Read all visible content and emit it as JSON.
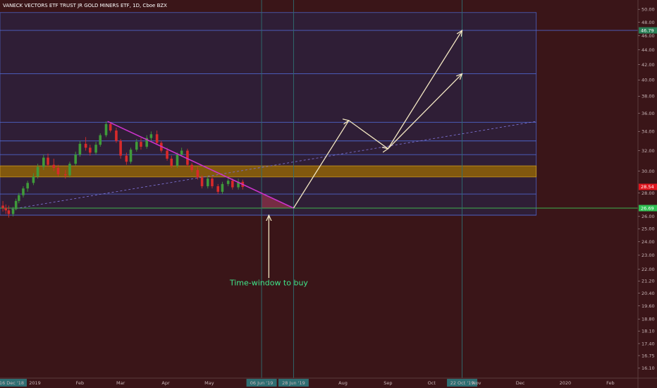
{
  "header": {
    "title": "VANECK VECTORS ETF TRUST JR GOLD MINERS ETF, 1D, Cboe BZX"
  },
  "colors": {
    "background": "#3a1518",
    "range_box": "#2f1f38",
    "range_lines": "#4f63c8",
    "resistance_band": "#8a5f0a",
    "support_line": "#3fb34f",
    "trendline": "#cc33cc",
    "arrow": "#f2e6c2",
    "up_candle": "#3f9a3a",
    "down_candle": "#d82a2a",
    "annotation_text": "#3fe58a",
    "price_tag_red": "#e0161e",
    "price_tag_green": "#2fbf52",
    "price_tag_last": "#2a7f56"
  },
  "annotation": {
    "label": "Time-window to buy"
  },
  "chart_data": {
    "type": "candlestick",
    "title": "VANECK VECTORS ETF TRUST JR GOLD MINERS ETF, 1D, Cboe BZX",
    "y_scale": "log",
    "ylim": [
      15.6,
      51.5
    ],
    "y_ticks": [
      "50.00",
      "48.00",
      "46.00",
      "44.00",
      "42.00",
      "40.00",
      "38.00",
      "36.00",
      "34.00",
      "32.00",
      "30.00",
      "28.00",
      "26.00",
      "25.00",
      "24.00",
      "23.00",
      "22.00",
      "21.20",
      "20.40",
      "19.60",
      "18.80",
      "18.10",
      "17.40",
      "16.75",
      "16.10"
    ],
    "x_tick_labels": [
      "16 Dec '18",
      "2019",
      "Feb",
      "Mar",
      "Apr",
      "May",
      "06 Jun '19",
      "28 Jun '19",
      "Aug",
      "Sep",
      "Oct",
      "22 Oct '19",
      "Nov",
      "Dec",
      "2020",
      "Feb"
    ],
    "x_range": [
      "2018-12-08",
      "2020-02-20"
    ],
    "price_tags": [
      {
        "label": "46.79",
        "value": 46.79,
        "style": "last"
      },
      {
        "label": "28.54",
        "value": 28.54,
        "style": "red"
      },
      {
        "label": "26.69",
        "value": 26.69,
        "style": "green"
      }
    ],
    "range_box": {
      "from": "2018-12-08",
      "to": "2019-12-12",
      "low": 26.1,
      "high": 49.5
    },
    "horizontal_levels": [
      46.79,
      40.8,
      35.0,
      33.0,
      31.6,
      27.9,
      26.1
    ],
    "resistance_band": [
      29.45,
      30.5
    ],
    "support_line": 26.69,
    "vertical_markers": [
      "2019-06-06",
      "2019-06-28",
      "2019-10-22"
    ],
    "trendline": {
      "from": [
        "2019-02-20",
        35.1
      ],
      "to": [
        "2019-06-28",
        26.69
      ]
    },
    "dashed_trendline": {
      "from": [
        "2018-12-16",
        26.6
      ],
      "to": [
        "2019-12-12",
        35.1
      ]
    },
    "shaded_window": [
      "2019-06-06",
      "2019-06-28"
    ],
    "projection_paths": [
      [
        [
          "2019-06-28",
          26.69
        ],
        [
          "2019-08-05",
          35.2
        ],
        [
          "2019-09-01",
          32.2
        ],
        [
          "2019-10-22",
          46.79
        ]
      ],
      [
        [
          "2019-09-01",
          32.2
        ],
        [
          "2019-10-22",
          40.8
        ]
      ]
    ],
    "annotation_arrow": {
      "from": [
        "2019-06-11",
        21.4
      ],
      "to": [
        "2019-06-11",
        26.1
      ]
    },
    "annotation_text": {
      "text": "Time-window to buy",
      "date": "2019-06-11",
      "value": 20.9
    },
    "ohlc": [
      {
        "d": "2018-12-10",
        "o": 26.9,
        "h": 27.3,
        "l": 26.4,
        "c": 26.7
      },
      {
        "d": "2018-12-12",
        "o": 26.7,
        "h": 27.0,
        "l": 26.2,
        "c": 26.5
      },
      {
        "d": "2018-12-14",
        "o": 26.5,
        "h": 26.9,
        "l": 25.9,
        "c": 26.2
      },
      {
        "d": "2018-12-17",
        "o": 26.2,
        "h": 26.8,
        "l": 26.0,
        "c": 26.6
      },
      {
        "d": "2018-12-19",
        "o": 26.6,
        "h": 27.5,
        "l": 26.5,
        "c": 27.3
      },
      {
        "d": "2018-12-21",
        "o": 27.3,
        "h": 28.0,
        "l": 27.1,
        "c": 27.8
      },
      {
        "d": "2018-12-24",
        "o": 27.8,
        "h": 28.6,
        "l": 27.6,
        "c": 28.4
      },
      {
        "d": "2018-12-27",
        "o": 28.4,
        "h": 29.1,
        "l": 28.1,
        "c": 28.9
      },
      {
        "d": "2018-12-31",
        "o": 28.9,
        "h": 29.8,
        "l": 28.7,
        "c": 29.5
      },
      {
        "d": "2019-01-03",
        "o": 29.5,
        "h": 30.7,
        "l": 29.3,
        "c": 30.4
      },
      {
        "d": "2019-01-07",
        "o": 30.4,
        "h": 31.6,
        "l": 30.1,
        "c": 31.3
      },
      {
        "d": "2019-01-10",
        "o": 31.3,
        "h": 31.7,
        "l": 30.4,
        "c": 30.6
      },
      {
        "d": "2019-01-14",
        "o": 30.6,
        "h": 31.2,
        "l": 30.0,
        "c": 30.3
      },
      {
        "d": "2019-01-17",
        "o": 30.3,
        "h": 30.6,
        "l": 29.5,
        "c": 29.7
      },
      {
        "d": "2019-01-22",
        "o": 29.7,
        "h": 30.1,
        "l": 29.3,
        "c": 29.6
      },
      {
        "d": "2019-01-25",
        "o": 29.6,
        "h": 30.9,
        "l": 29.4,
        "c": 30.7
      },
      {
        "d": "2019-01-29",
        "o": 30.7,
        "h": 31.9,
        "l": 30.5,
        "c": 31.6
      },
      {
        "d": "2019-02-01",
        "o": 31.6,
        "h": 33.0,
        "l": 31.4,
        "c": 32.7
      },
      {
        "d": "2019-02-05",
        "o": 32.7,
        "h": 33.4,
        "l": 32.0,
        "c": 32.3
      },
      {
        "d": "2019-02-08",
        "o": 32.3,
        "h": 32.6,
        "l": 31.5,
        "c": 31.8
      },
      {
        "d": "2019-02-12",
        "o": 31.8,
        "h": 32.9,
        "l": 31.6,
        "c": 32.6
      },
      {
        "d": "2019-02-15",
        "o": 32.6,
        "h": 33.8,
        "l": 32.4,
        "c": 33.6
      },
      {
        "d": "2019-02-19",
        "o": 33.6,
        "h": 35.1,
        "l": 33.4,
        "c": 34.8
      },
      {
        "d": "2019-02-22",
        "o": 34.8,
        "h": 35.0,
        "l": 33.9,
        "c": 34.1
      },
      {
        "d": "2019-02-26",
        "o": 34.1,
        "h": 34.4,
        "l": 32.8,
        "c": 33.0
      },
      {
        "d": "2019-03-01",
        "o": 33.0,
        "h": 33.2,
        "l": 31.2,
        "c": 31.5
      },
      {
        "d": "2019-03-05",
        "o": 31.5,
        "h": 31.8,
        "l": 30.6,
        "c": 30.9
      },
      {
        "d": "2019-03-08",
        "o": 30.9,
        "h": 32.3,
        "l": 30.7,
        "c": 32.1
      },
      {
        "d": "2019-03-12",
        "o": 32.1,
        "h": 33.2,
        "l": 31.9,
        "c": 32.9
      },
      {
        "d": "2019-03-15",
        "o": 32.9,
        "h": 33.3,
        "l": 32.1,
        "c": 32.4
      },
      {
        "d": "2019-03-19",
        "o": 32.4,
        "h": 33.6,
        "l": 32.2,
        "c": 33.3
      },
      {
        "d": "2019-03-22",
        "o": 33.3,
        "h": 34.0,
        "l": 33.0,
        "c": 33.7
      },
      {
        "d": "2019-03-26",
        "o": 33.7,
        "h": 34.1,
        "l": 32.6,
        "c": 32.8
      },
      {
        "d": "2019-03-29",
        "o": 32.8,
        "h": 33.0,
        "l": 31.8,
        "c": 32.0
      },
      {
        "d": "2019-04-02",
        "o": 32.0,
        "h": 32.3,
        "l": 31.0,
        "c": 31.2
      },
      {
        "d": "2019-04-05",
        "o": 31.2,
        "h": 31.5,
        "l": 30.3,
        "c": 30.5
      },
      {
        "d": "2019-04-09",
        "o": 30.5,
        "h": 31.8,
        "l": 30.3,
        "c": 31.6
      },
      {
        "d": "2019-04-12",
        "o": 31.6,
        "h": 32.3,
        "l": 31.4,
        "c": 32.0
      },
      {
        "d": "2019-04-16",
        "o": 32.0,
        "h": 32.2,
        "l": 30.4,
        "c": 30.6
      },
      {
        "d": "2019-04-19",
        "o": 30.6,
        "h": 30.8,
        "l": 29.9,
        "c": 30.1
      },
      {
        "d": "2019-04-23",
        "o": 30.1,
        "h": 30.4,
        "l": 29.2,
        "c": 29.4
      },
      {
        "d": "2019-04-26",
        "o": 29.4,
        "h": 29.6,
        "l": 28.4,
        "c": 28.6
      },
      {
        "d": "2019-04-30",
        "o": 28.6,
        "h": 29.5,
        "l": 28.4,
        "c": 29.3
      },
      {
        "d": "2019-05-03",
        "o": 29.3,
        "h": 29.5,
        "l": 28.4,
        "c": 28.6
      },
      {
        "d": "2019-05-07",
        "o": 28.6,
        "h": 28.8,
        "l": 27.9,
        "c": 28.1
      },
      {
        "d": "2019-05-10",
        "o": 28.1,
        "h": 29.0,
        "l": 27.9,
        "c": 28.8
      },
      {
        "d": "2019-05-14",
        "o": 28.8,
        "h": 29.4,
        "l": 28.6,
        "c": 29.1
      },
      {
        "d": "2019-05-17",
        "o": 29.1,
        "h": 29.3,
        "l": 28.3,
        "c": 28.5
      },
      {
        "d": "2019-05-21",
        "o": 28.5,
        "h": 29.3,
        "l": 28.3,
        "c": 29.0
      },
      {
        "d": "2019-05-24",
        "o": 29.0,
        "h": 29.2,
        "l": 28.3,
        "c": 28.54
      }
    ]
  }
}
